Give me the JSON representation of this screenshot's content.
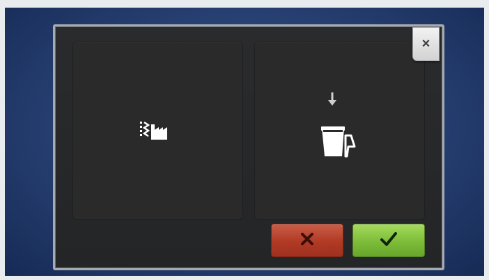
{
  "dialog": {
    "close_button": {
      "label": "×",
      "icon": "close-icon"
    },
    "options": [
      {
        "icon": "embroidery-factory-icon"
      },
      {
        "icon": "bobbin-down-arrow-icon"
      }
    ],
    "buttons": {
      "cancel": {
        "icon": "cross-icon",
        "color": "#b13a24"
      },
      "confirm": {
        "icon": "check-icon",
        "color": "#7dbc39"
      }
    }
  }
}
